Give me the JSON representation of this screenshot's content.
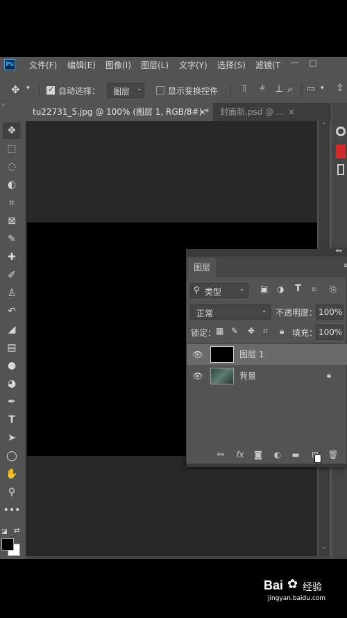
{
  "menubar": {
    "logo": "Ps",
    "items": [
      "文件(F)",
      "编辑(E)",
      "图像(I)",
      "图层(L)",
      "文字(Y)",
      "选择(S)",
      "滤镜(T"
    ],
    "minimize": "—",
    "maximize": "□"
  },
  "options": {
    "auto_select_label": "自动选择：",
    "auto_select_value": "图层",
    "show_transform_label": "显示变换控件"
  },
  "tabs": [
    {
      "label": "tu22731_5.jpg @ 100% (图层 1, RGB/8#) *",
      "close": "×"
    },
    {
      "label": "封面新.psd @ ...",
      "close": "×"
    }
  ],
  "layers_panel": {
    "tab_label": "图层",
    "filter_label": "类型",
    "blend_mode": "正常",
    "opacity_label": "不透明度：",
    "opacity_value": "100%",
    "lock_label": "锁定：",
    "fill_label": "填充：",
    "fill_value": "100%",
    "layers": [
      {
        "name": "图层 1",
        "selected": true
      },
      {
        "name": "背景",
        "selected": false
      }
    ]
  },
  "watermark": {
    "brand": "Bai",
    "brand2": "经验",
    "url": "jingyan.baidu.com"
  },
  "colors": {
    "ui_gray": "#535353",
    "canvas_bg": "#282828",
    "accent": "#31a8ff"
  }
}
